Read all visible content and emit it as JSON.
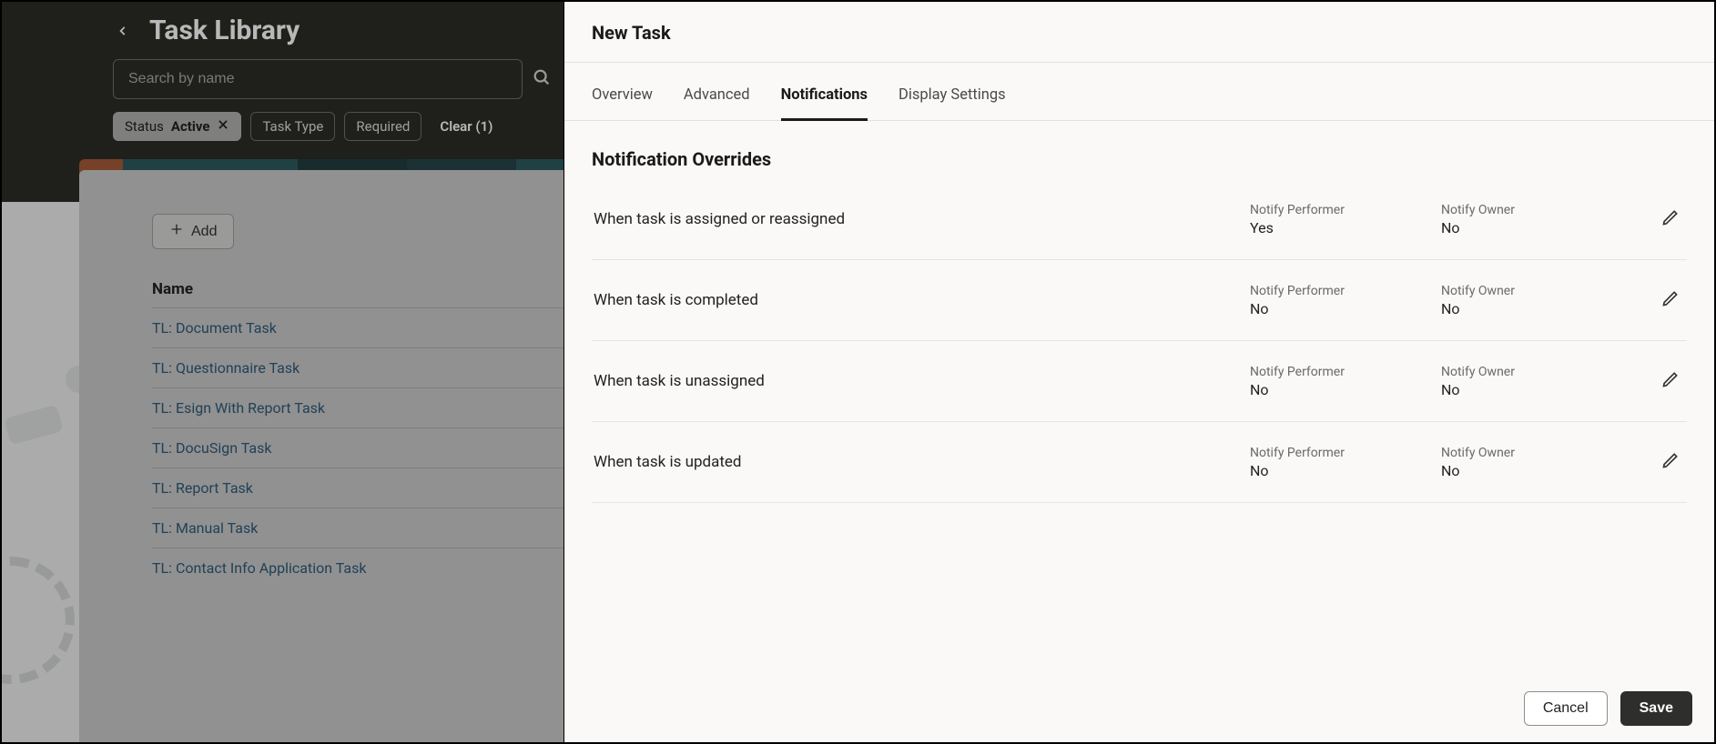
{
  "task_library": {
    "title": "Task Library",
    "search_placeholder": "Search by name",
    "filters": {
      "status_label": "Status",
      "status_value": "Active",
      "task_type": "Task Type",
      "required": "Required",
      "clear": "Clear (1)"
    },
    "add_label": "Add",
    "column_header": "Name",
    "rows": [
      "TL: Document Task",
      "TL: Questionnaire Task",
      "TL: Esign With Report Task",
      "TL: DocuSign Task",
      "TL: Report Task",
      "TL: Manual Task",
      "TL: Contact Info Application Task"
    ]
  },
  "panel": {
    "title": "New Task",
    "tabs": [
      "Overview",
      "Advanced",
      "Notifications",
      "Display Settings"
    ],
    "active_tab_index": 2,
    "section_title": "Notification Overrides",
    "labels": {
      "notify_performer": "Notify Performer",
      "notify_owner": "Notify Owner"
    },
    "overrides": [
      {
        "event": "When task is assigned or reassigned",
        "performer": "Yes",
        "owner": "No"
      },
      {
        "event": "When task is completed",
        "performer": "No",
        "owner": "No"
      },
      {
        "event": "When task is unassigned",
        "performer": "No",
        "owner": "No"
      },
      {
        "event": "When task is updated",
        "performer": "No",
        "owner": "No"
      }
    ],
    "buttons": {
      "cancel": "Cancel",
      "save": "Save"
    }
  }
}
